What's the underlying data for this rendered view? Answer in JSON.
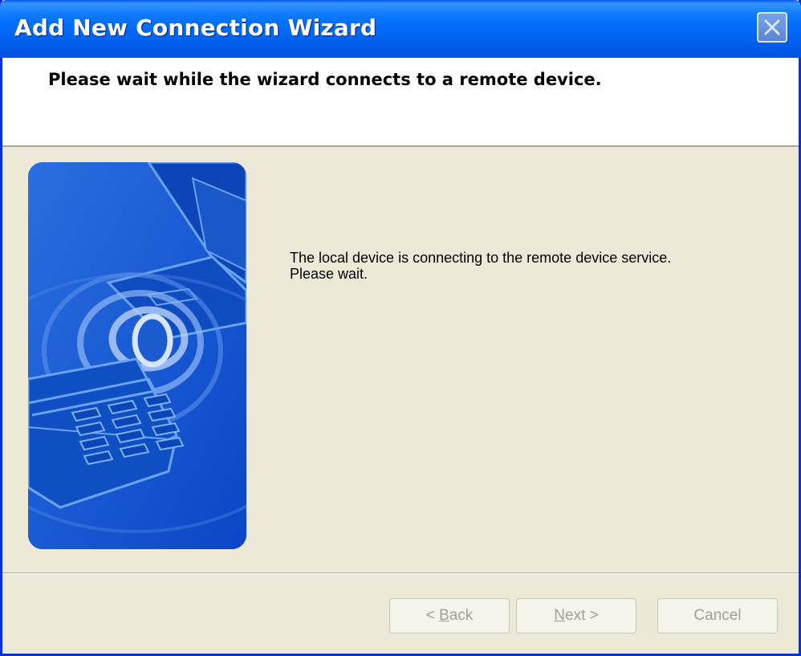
{
  "window": {
    "title": "Add New Connection Wizard"
  },
  "header": {
    "title": "Please wait while the wizard connects to a remote device."
  },
  "message": {
    "line1": "The local device is connecting to the remote device service.",
    "line2": "Please wait."
  },
  "buttons": {
    "back": {
      "prefix": "< ",
      "mnemonic": "B",
      "rest": "ack"
    },
    "next": {
      "mnemonic": "N",
      "rest": "ext >"
    },
    "cancel": {
      "label": "Cancel"
    }
  },
  "colors": {
    "titlebar": "#0054e3",
    "dialog_bg": "#ece9d8",
    "illustration_blue": "#0f54d6",
    "disabled_text": "#a1a192"
  },
  "icons": {
    "close": "close-icon",
    "illustration": "laptop-phone-wireless-illustration"
  }
}
